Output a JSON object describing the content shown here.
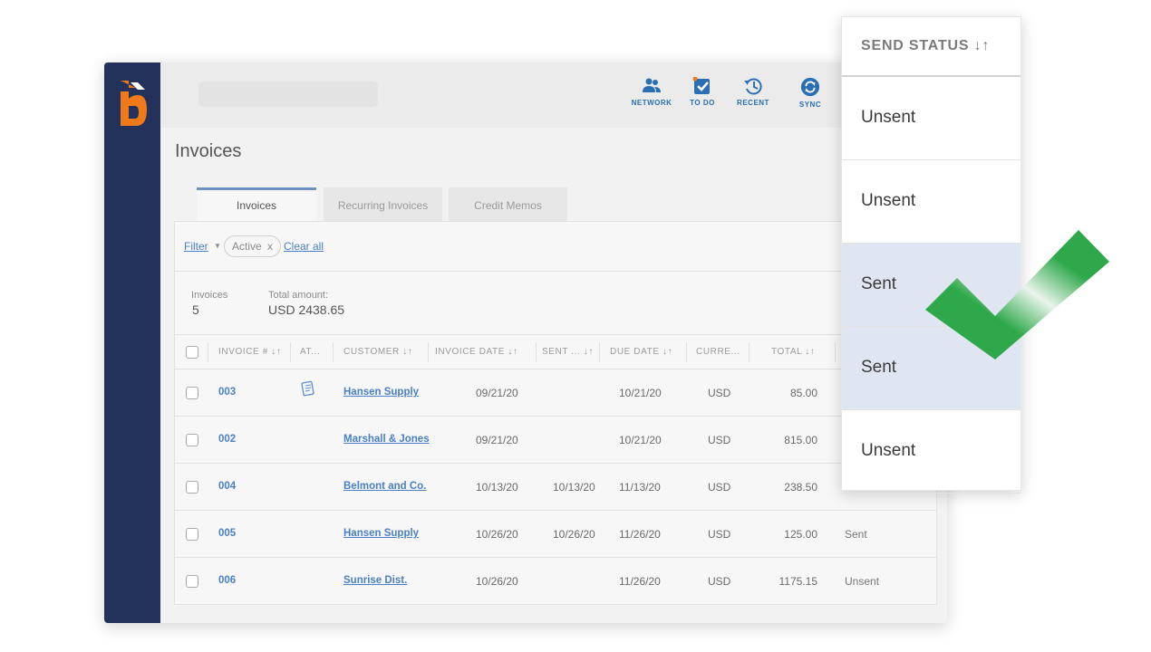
{
  "topbar": {
    "nav": [
      {
        "id": "network",
        "label": "NETWORK",
        "icon": "network-icon"
      },
      {
        "id": "todo",
        "label": "TO DO",
        "icon": "todo-icon"
      },
      {
        "id": "recent",
        "label": "RECENT",
        "icon": "recent-icon"
      },
      {
        "id": "sync",
        "label": "SYNC",
        "icon": "sync-icon"
      }
    ]
  },
  "page": {
    "title": "Invoices"
  },
  "tabs": [
    {
      "label": "Invoices",
      "active": true
    },
    {
      "label": "Recurring Invoices",
      "active": false
    },
    {
      "label": "Credit Memos",
      "active": false
    }
  ],
  "filter": {
    "label": "Filter",
    "chip": "Active",
    "chip_close": "x",
    "clear": "Clear all"
  },
  "summary": {
    "invoices_label": "Invoices",
    "invoices_count": "5",
    "total_label": "Total amount:",
    "total_value": "USD 2438.65"
  },
  "table": {
    "headers": {
      "invoice": "INVOICE # ↓↑",
      "attach": "AT...",
      "customer": "CUSTOMER ↓↑",
      "invoice_date": "INVOICE DATE ↓↑",
      "sent": "SENT ... ↓↑",
      "due": "DUE DATE ↓↑",
      "currency": "CURRE...",
      "total": "TOTAL ↓↑"
    },
    "rows": [
      {
        "num": "003",
        "attachment": true,
        "customer": "Hansen Supply",
        "invoice_date": "09/21/20",
        "sent_date": "",
        "due": "10/21/20",
        "currency": "USD",
        "total": "85.00",
        "status": ""
      },
      {
        "num": "002",
        "attachment": false,
        "customer": "Marshall & Jones",
        "invoice_date": "09/21/20",
        "sent_date": "",
        "due": "10/21/20",
        "currency": "USD",
        "total": "815.00",
        "status": ""
      },
      {
        "num": "004",
        "attachment": false,
        "customer": "Belmont and Co.",
        "invoice_date": "10/13/20",
        "sent_date": "10/13/20",
        "due": "11/13/20",
        "currency": "USD",
        "total": "238.50",
        "status": ""
      },
      {
        "num": "005",
        "attachment": false,
        "customer": "Hansen Supply",
        "invoice_date": "10/26/20",
        "sent_date": "10/26/20",
        "due": "11/26/20",
        "currency": "USD",
        "total": "125.00",
        "status": "Sent"
      },
      {
        "num": "006",
        "attachment": false,
        "customer": "Sunrise Dist.",
        "invoice_date": "10/26/20",
        "sent_date": "",
        "due": "11/26/20",
        "currency": "USD",
        "total": "1175.15",
        "status": "Unsent"
      }
    ]
  },
  "overlay": {
    "header": "SEND STATUS ↓↑",
    "rows": [
      {
        "label": "Unsent",
        "highlight": false
      },
      {
        "label": "Unsent",
        "highlight": false
      },
      {
        "label": "Sent",
        "highlight": true
      },
      {
        "label": "Sent",
        "highlight": true
      },
      {
        "label": "Unsent",
        "highlight": false
      }
    ]
  },
  "colors": {
    "rail": "#22325a",
    "brand": "#f07a1a",
    "accent": "#2a6fb3",
    "link": "#4a80c7",
    "check": "#2ea84a",
    "highlight": "#dfe5f1"
  }
}
